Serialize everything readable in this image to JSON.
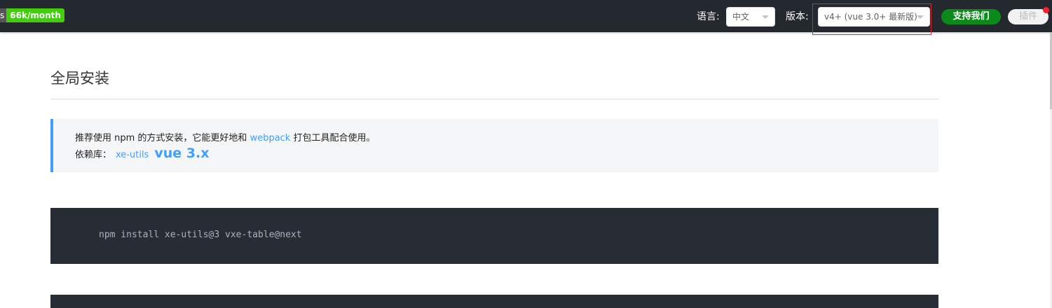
{
  "header": {
    "badge_left": "s",
    "badge_right": "66k/month",
    "language_label": "语言:",
    "language_value": "中文",
    "version_label": "版本:",
    "version_value": "v4+ (vue 3.0+ 最新版)",
    "support_button": "支持我们",
    "plugin_button": "插件"
  },
  "main": {
    "title": "全局安装",
    "tip": {
      "line1_prefix": "推荐使用 npm 的方式安装，它能更好地和 ",
      "line1_link": "webpack",
      "line1_suffix": " 打包工具配合使用。",
      "line2_label": "依赖库：",
      "line2_link": "xe-utils",
      "line2_vue": "vue 3.x"
    },
    "code": "npm install xe-utils@3 vxe-table@next"
  },
  "colors": {
    "header_bg": "#24292f",
    "accent": "#409eff",
    "support_green": "#0b8a1a",
    "highlight_red": "#e0262a",
    "code_bg": "#282c34"
  }
}
